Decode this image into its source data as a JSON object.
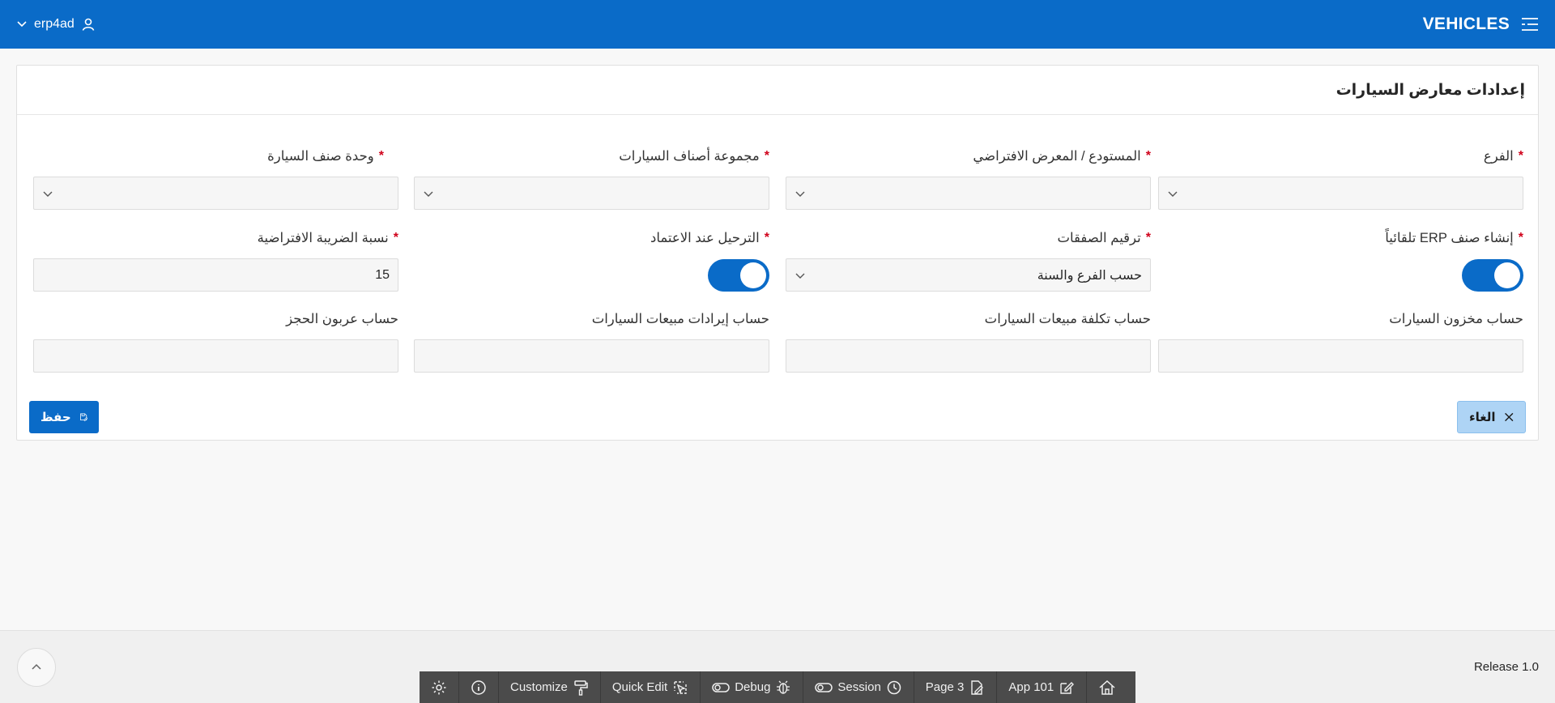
{
  "header": {
    "username": "erp4ad",
    "app_title": "VEHICLES"
  },
  "region": {
    "title": "إعدادات معارض السيارات"
  },
  "fields": {
    "branch": {
      "label": "الفرع",
      "required": "*",
      "value": ""
    },
    "warehouse": {
      "label": "المستودع / المعرض الافتراضي",
      "required": "*",
      "value": ""
    },
    "car_category_group": {
      "label": "مجموعة أصناف السيارات",
      "required": "*",
      "value": ""
    },
    "car_item_unit": {
      "label": "وحدة صنف السيارة",
      "required": "*",
      "value": ""
    },
    "auto_erp_item": {
      "label": "إنشاء صنف ERP تلقائياً",
      "required": "*",
      "state": "on"
    },
    "transaction_numbering": {
      "label": "ترقيم الصفقات",
      "required": "*",
      "value": "حسب الفرع والسنة"
    },
    "post_on_approval": {
      "label": "الترحيل عند الاعتماد",
      "required": "*",
      "state": "on"
    },
    "default_tax_rate": {
      "label": "نسبة الضريبة الافتراضية",
      "required": "*",
      "value": "15"
    },
    "car_inventory_account": {
      "label": "حساب مخزون السيارات",
      "value": ""
    },
    "car_sales_cost_account": {
      "label": "حساب تكلفة مبيعات السيارات",
      "value": ""
    },
    "car_sales_revenue_account": {
      "label": "حساب إيرادات مبيعات السيارات",
      "value": ""
    },
    "booking_deposit_account": {
      "label": "حساب عربون الحجز",
      "value": ""
    }
  },
  "buttons": {
    "save": "حفظ",
    "cancel": "الغاء"
  },
  "footer": {
    "release": "Release 1.0"
  },
  "devbar": {
    "customize": "Customize",
    "quick_edit": "Quick Edit",
    "debug": "Debug",
    "session": "Session",
    "page": "Page 3",
    "app": "App 101"
  },
  "colors": {
    "header": "#0a6bc8",
    "primary_button": "#0a6bc8",
    "cancel_button": "#aed4f5",
    "required": "#d0021b",
    "devbar": "#4b4b4b"
  },
  "icons": {
    "header_user": "user-icon",
    "header_menu": "menu-icon",
    "save": "save-icon",
    "cancel": "close-icon",
    "scroll_top": "chevron-up-icon"
  }
}
